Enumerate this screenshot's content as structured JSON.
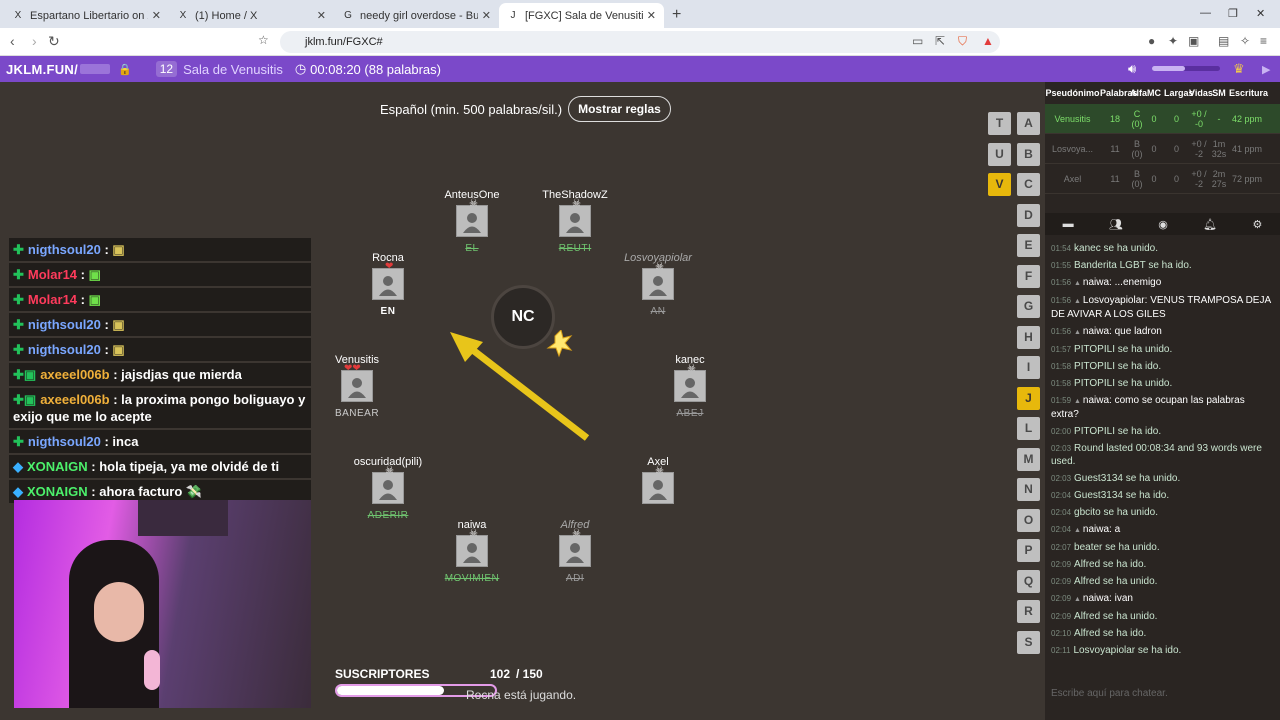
{
  "browser": {
    "tabs": [
      {
        "title": "Espartano Libertario on X: \"@laderes...",
        "icon": "X"
      },
      {
        "title": "(1) Home / X",
        "icon": "X"
      },
      {
        "title": "needy girl overdose - Buscar con Goo...",
        "icon": "G"
      },
      {
        "title": "[FGXC] Sala de Venusitis",
        "icon": "J"
      }
    ],
    "url": "jklm.fun/FGXC#"
  },
  "app": {
    "logo": "JKLM.FUN/",
    "room_number": "12",
    "room_name": "Sala de Venusitis",
    "timer": "00:08:20 (88 palabras)"
  },
  "rules": {
    "text": "Español (min. 500 palabras/sil.)",
    "button": "Mostrar reglas"
  },
  "bomb_syllable": "NC",
  "players": [
    {
      "name": "AnteusOne",
      "word": "EL",
      "italic": false,
      "mark": "skull",
      "style": "strike"
    },
    {
      "name": "TheShadowZ",
      "word": "REUTI",
      "italic": false,
      "mark": "skull",
      "style": "strike"
    },
    {
      "name": "Rocna",
      "word": "EN",
      "italic": false,
      "mark": "heart",
      "style": "plain"
    },
    {
      "name": "Losvoyapiolar",
      "word": "AN",
      "italic": true,
      "mark": "skull",
      "style": "gray"
    },
    {
      "name": "Venusitis",
      "word": "BANEAR",
      "italic": false,
      "mark": "hearts",
      "style": "partial"
    },
    {
      "name": "kanec",
      "word": "ABEJ",
      "italic": false,
      "mark": "skull",
      "style": "gray"
    },
    {
      "name": "oscuridad(pili)",
      "word": "ADERIR",
      "italic": false,
      "mark": "skull",
      "style": "strike"
    },
    {
      "name": "Axel",
      "word": "",
      "italic": false,
      "mark": "skull",
      "style": "plain"
    },
    {
      "name": "naiwa",
      "word": "MOVIMIEN",
      "italic": false,
      "mark": "skull",
      "style": "strike"
    },
    {
      "name": "Alfred",
      "word": "ADI",
      "italic": true,
      "mark": "skull",
      "style": "gray"
    }
  ],
  "letters_left": [
    "T",
    "U",
    "V"
  ],
  "letters_right": [
    "A",
    "B",
    "C",
    "D",
    "E",
    "F",
    "G",
    "H",
    "I",
    "J",
    "L",
    "M",
    "N",
    "O",
    "P",
    "Q",
    "R",
    "S"
  ],
  "subs": {
    "label": "SUSCRIPTORES",
    "count": "102",
    "total": "/ 150",
    "progress": 0.68
  },
  "status": "Rocna está jugando.",
  "stream_chat": [
    {
      "user": "nigthsoul20",
      "msg": "",
      "color": "#7aa7ff",
      "emote": "face"
    },
    {
      "user": "Molar14",
      "msg": "",
      "color": "#ff3b5c",
      "emote": "cat"
    },
    {
      "user": "Molar14",
      "msg": "",
      "color": "#ff3b5c",
      "emote": "cat"
    },
    {
      "user": "nigthsoul20",
      "msg": "",
      "color": "#7aa7ff",
      "emote": "duck"
    },
    {
      "user": "nigthsoul20",
      "msg": "",
      "color": "#7aa7ff",
      "emote": "face2"
    },
    {
      "user": "axeeel006b",
      "msg": "jajsdjas que mierda",
      "color": "#f0b03a",
      "emote": ""
    },
    {
      "user": "axeeel006b",
      "msg": "la proxima pongo boliguayo y exijo que me lo acepte",
      "color": "#f0b03a",
      "emote": ""
    },
    {
      "user": "nigthsoul20",
      "msg": "inca",
      "color": "#7aa7ff",
      "emote": ""
    },
    {
      "user": "XONAIGN",
      "msg": "hola tipeja, ya me olvidé de ti",
      "color": "#4cf06b",
      "emote": ""
    },
    {
      "user": "XONAIGN",
      "msg": "ahora facturo 💸",
      "color": "#4cf06b",
      "emote": ""
    }
  ],
  "scoreboard": {
    "headers": [
      "Pseudónimo",
      "Palabras",
      "Alfa",
      "MC",
      "Largas",
      "Vidas",
      "SM",
      "Escritura"
    ],
    "rows": [
      {
        "name": "Venusitis",
        "words": "18",
        "alpha": "C (0)",
        "mc": "0",
        "long": "0",
        "lives": "+0 / -0",
        "sm": "-",
        "speed": "42 ppm",
        "me": true
      },
      {
        "name": "Losvoya...",
        "words": "11",
        "alpha": "B (0)",
        "mc": "0",
        "long": "0",
        "lives": "+0 / -2",
        "sm": "1m 32s",
        "speed": "41 ppm",
        "me": false
      },
      {
        "name": "Axel",
        "words": "11",
        "alpha": "B (0)",
        "mc": "0",
        "long": "0",
        "lives": "+0 / -2",
        "sm": "2m 27s",
        "speed": "72 ppm",
        "me": false
      }
    ]
  },
  "room_chat": [
    {
      "time": "01:54",
      "user": "",
      "msg": "kanec se ha unido."
    },
    {
      "time": "01:55",
      "user": "",
      "msg": "Banderita LGBT se ha ido."
    },
    {
      "time": "01:56",
      "user": "naiwa",
      "msg": "...enemigo"
    },
    {
      "time": "01:56",
      "user": "Losvoyapiolar",
      "msg": "VENUS TRAMPOSA DEJA DE AVIVAR A LOS GILES"
    },
    {
      "time": "01:56",
      "user": "naiwa",
      "msg": "que ladron"
    },
    {
      "time": "01:57",
      "user": "",
      "msg": "PITOPILI se ha unido."
    },
    {
      "time": "01:58",
      "user": "",
      "msg": "PITOPILI se ha ido."
    },
    {
      "time": "01:58",
      "user": "",
      "msg": "PITOPILI se ha unido."
    },
    {
      "time": "01:59",
      "user": "naiwa",
      "msg": "como se ocupan las palabras extra?"
    },
    {
      "time": "02:00",
      "user": "",
      "msg": "PITOPILI se ha ido."
    },
    {
      "time": "02:03",
      "user": "",
      "msg": "Round lasted 00:08:34 and 93 words were used."
    },
    {
      "time": "02:03",
      "user": "",
      "msg": "Guest3134 se ha unido."
    },
    {
      "time": "02:04",
      "user": "",
      "msg": "Guest3134 se ha ido."
    },
    {
      "time": "02:04",
      "user": "",
      "msg": "gbcito se ha unido."
    },
    {
      "time": "02:04",
      "user": "naiwa",
      "msg": "a"
    },
    {
      "time": "02:07",
      "user": "",
      "msg": "beater se ha unido."
    },
    {
      "time": "02:09",
      "user": "",
      "msg": "Alfred  se ha ido."
    },
    {
      "time": "02:09",
      "user": "",
      "msg": "Alfred  se ha unido."
    },
    {
      "time": "02:09",
      "user": "naiwa",
      "msg": "ivan"
    },
    {
      "time": "02:09",
      "user": "",
      "msg": "Alfred  se ha unido."
    },
    {
      "time": "02:10",
      "user": "",
      "msg": "Alfred  se ha ido."
    },
    {
      "time": "02:11",
      "user": "",
      "msg": "Losvoyapiolar se ha ido."
    }
  ],
  "chat_placeholder": "Escribe aquí para chatear."
}
